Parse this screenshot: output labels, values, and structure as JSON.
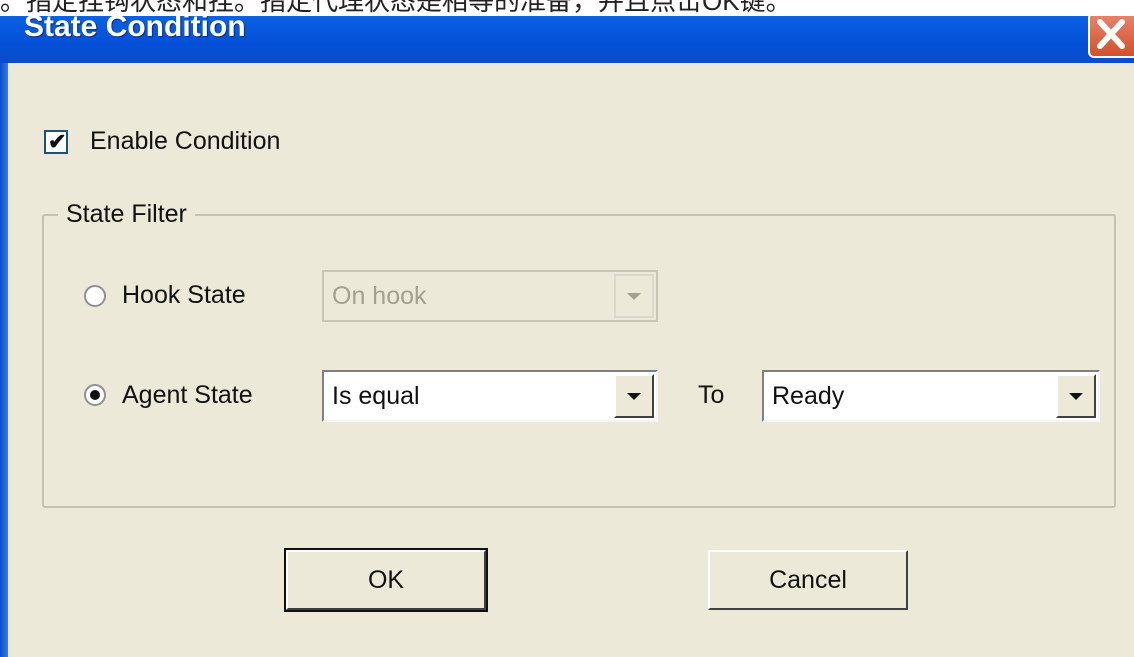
{
  "caption": "。指定挂钩状态和挂。指定代理状态是相等的准备，并且点击OK键。",
  "window": {
    "title": "State Condition"
  },
  "enable_condition": {
    "label": "Enable Condition",
    "checked": true
  },
  "state_filter": {
    "legend": "State Filter",
    "hook_state": {
      "label": "Hook State",
      "selected": false,
      "value": "On hook",
      "enabled": false
    },
    "agent_state": {
      "label": "Agent State",
      "selected": true,
      "operator": "Is equal",
      "to_label": "To",
      "value": "Ready"
    }
  },
  "buttons": {
    "ok": "OK",
    "cancel": "Cancel"
  },
  "colors": {
    "titlebar": "#0550d8",
    "dialog_bg": "#ece9d8",
    "close": "#d2502e"
  },
  "icons": {
    "close": "close-icon",
    "check": "check-icon",
    "dropdown": "chevron-down-icon"
  }
}
